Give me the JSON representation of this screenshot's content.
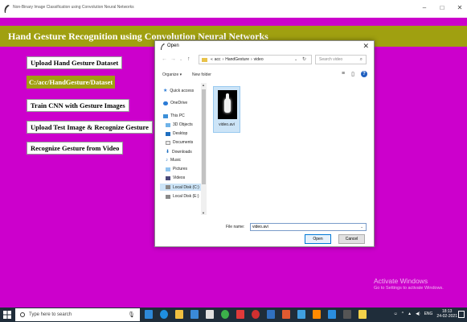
{
  "window": {
    "title": "Non-Binary Image Classification using Convolution Neural Networks",
    "controls": {
      "minimize": "–",
      "maximize": "□",
      "close": "✕"
    }
  },
  "app": {
    "header": "Hand Gesture Recognition using Convolution Neural Networks",
    "buttons": [
      "Upload Hand Gesture Dataset",
      "Train CNN with Gesture Images",
      "Upload Test Image & Recognize Gesture",
      "Recognize Gesture from Video"
    ],
    "path_label": "C:/acc/HandGesture/Dataset",
    "colors": {
      "background": "#cc00cc",
      "header": "#a0a010"
    }
  },
  "dialog": {
    "title": "Open",
    "breadcrumb": [
      "«",
      "acc",
      "›",
      "HandGesture",
      "›",
      "video"
    ],
    "search_placeholder": "Search video",
    "organize": "Organize ▾",
    "new_folder": "New folder",
    "nav_items": [
      {
        "label": "Quick access",
        "icon": "star-icon"
      },
      {
        "label": "OneDrive",
        "icon": "cloud-icon"
      },
      {
        "label": "This PC",
        "icon": "computer-icon"
      },
      {
        "label": "3D Objects",
        "icon": "cube-icon"
      },
      {
        "label": "Desktop",
        "icon": "desktop-icon"
      },
      {
        "label": "Documents",
        "icon": "document-icon"
      },
      {
        "label": "Downloads",
        "icon": "download-icon"
      },
      {
        "label": "Music",
        "icon": "music-icon"
      },
      {
        "label": "Pictures",
        "icon": "picture-icon"
      },
      {
        "label": "Videos",
        "icon": "video-icon"
      },
      {
        "label": "Local Disk (C:)",
        "icon": "disk-icon"
      },
      {
        "label": "Local Disk (E:)",
        "icon": "disk-icon"
      }
    ],
    "file": {
      "name": "video.avi"
    },
    "filename_label": "File name:",
    "filename_value": "video.avi",
    "open_label": "Open",
    "cancel_label": "Cancel"
  },
  "desktop": {
    "activate_title": "Activate Windows",
    "activate_sub": "Go to Settings to activate Windows."
  },
  "taskbar": {
    "search_placeholder": "Type here to search",
    "time": "18:13",
    "date": "24-02-2021",
    "lang": "ENG"
  }
}
